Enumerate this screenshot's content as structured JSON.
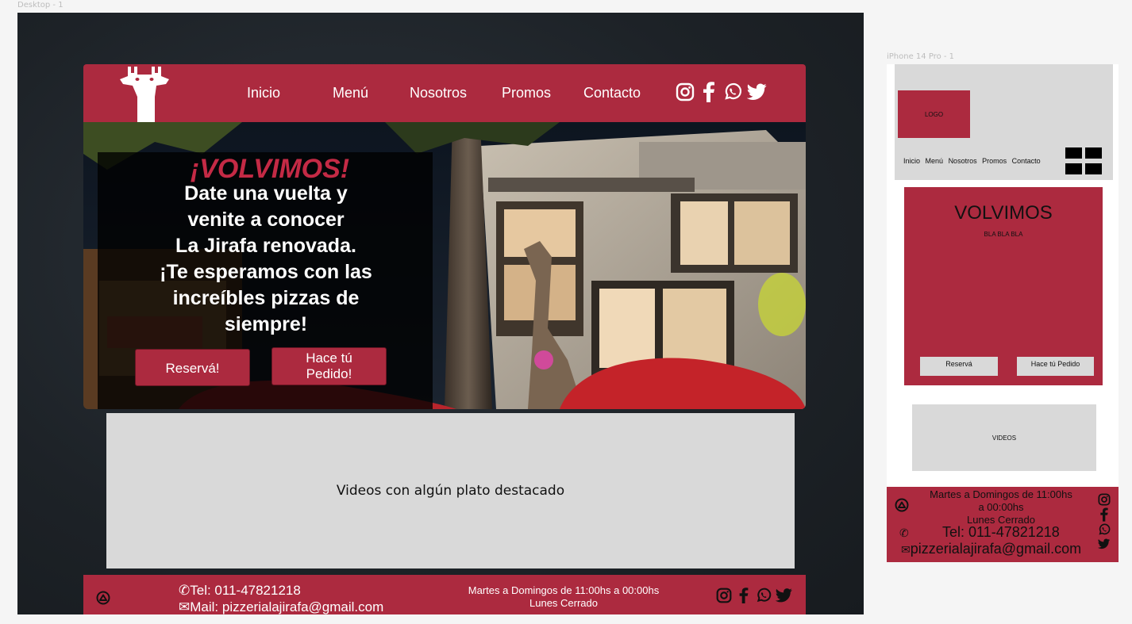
{
  "frames": {
    "desktop_label": "Desktop - 1",
    "mobile_label": "iPhone 14 Pro - 1"
  },
  "colors": {
    "brand": "#ac2a3f",
    "placeholder": "#d9d9d9"
  },
  "desktop": {
    "nav": {
      "items": [
        {
          "label": "Inicio"
        },
        {
          "label": "Menú"
        },
        {
          "label": "Nosotros"
        },
        {
          "label": "Promos"
        },
        {
          "label": "Contacto"
        }
      ],
      "social_icons": [
        "instagram-icon",
        "facebook-icon",
        "whatsapp-icon",
        "twitter-icon"
      ]
    },
    "hero": {
      "title": "¡VOLVIMOS!",
      "lines": [
        "Date una vuelta y",
        "venite a conocer",
        "La Jirafa renovada.",
        "¡Te esperamos con las",
        "increíbles pizzas de",
        "siempre!"
      ],
      "btn_reserva": "Reservá!",
      "btn_pedido_1": "Hace tú",
      "btn_pedido_2": "Pedido!"
    },
    "videos": {
      "label": "Videos con algún plato destacado"
    },
    "footer": {
      "tel": "Tel: 011-47821218",
      "mail": "Mail: pizzerialajirafa@gmail.com",
      "hours_1": "Martes a Domingos de 11:00hs a 00:00hs",
      "hours_2": "Lunes Cerrado"
    }
  },
  "mobile": {
    "logo": "LOGO",
    "nav": [
      "Inicio",
      "Menú",
      "Nosotros",
      "Promos",
      "Contacto"
    ],
    "hero": {
      "title": "VOLVIMOS",
      "subtitle": "BLA BLA BLA",
      "btn_reserva": "Reservá",
      "btn_pedido": "Hace tú Pedido"
    },
    "videos": "VIDEOS",
    "footer": {
      "hours_1": "Martes a Domingos de 11:00hs",
      "hours_2": "a 00:00hs",
      "hours_3": "Lunes Cerrado",
      "tel": "Tel: 011-47821218",
      "mail": "pizzerialajirafa@gmail.com"
    }
  }
}
